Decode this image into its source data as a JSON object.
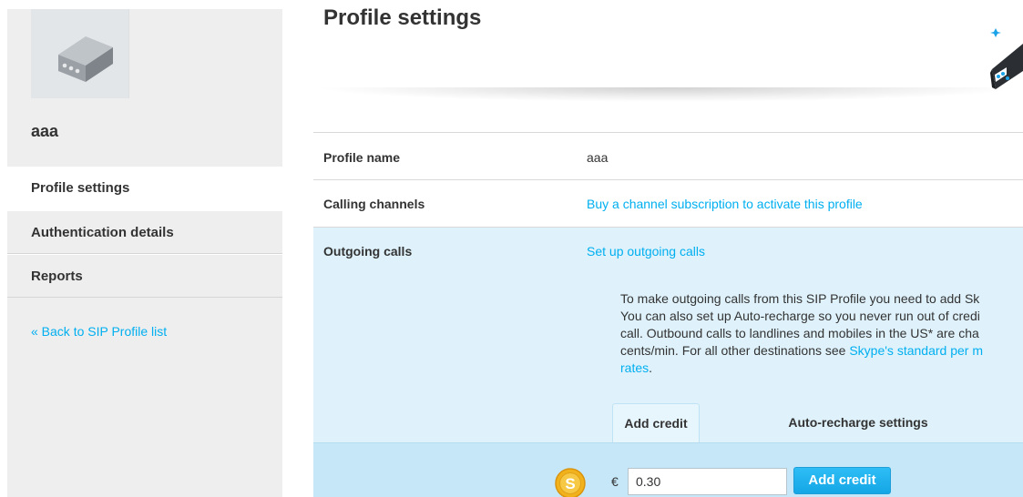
{
  "sidebar": {
    "profile_name": "aaa",
    "nav": [
      {
        "label": "Profile settings",
        "active": true
      },
      {
        "label": "Authentication details",
        "active": false
      },
      {
        "label": "Reports",
        "active": false
      }
    ],
    "back_link": "« Back to SIP Profile list"
  },
  "main": {
    "title": "Profile settings",
    "rows": {
      "profile_name": {
        "label": "Profile name",
        "value": "aaa"
      },
      "calling_channels": {
        "label": "Calling channels",
        "link": "Buy a channel subscription to activate this profile"
      },
      "outgoing_calls": {
        "label": "Outgoing calls",
        "link": "Set up outgoing calls"
      }
    },
    "info": {
      "lines": [
        "To make outgoing calls from this SIP Profile you need to add Sk",
        "You can also set up Auto-recharge so you never run out of credi",
        "call. Outbound calls to landlines and mobiles in the US* are cha"
      ],
      "line4_prefix": "cents/min. For all other destinations see ",
      "rates_link_1": "Skype's standard per m",
      "rates_link_2": "rates",
      "rates_suffix": "."
    },
    "tabs": [
      {
        "label": "Add credit",
        "active": true
      },
      {
        "label": "Auto-recharge settings",
        "active": false
      }
    ],
    "credit": {
      "currency_symbol": "€",
      "amount": "0.30",
      "button_label": "Add credit"
    }
  },
  "colors": {
    "accent_link": "#00aff0",
    "panel_blue": "#dff2fb",
    "panel_blue_dark": "#c6e7f7",
    "button_blue": "#14a6e6",
    "coin_gold": "#f2b21c"
  },
  "icons": {
    "avatar": "sip-device-icon",
    "header": "sip-device-illustration",
    "coin": "skype-credit-coin-icon"
  }
}
